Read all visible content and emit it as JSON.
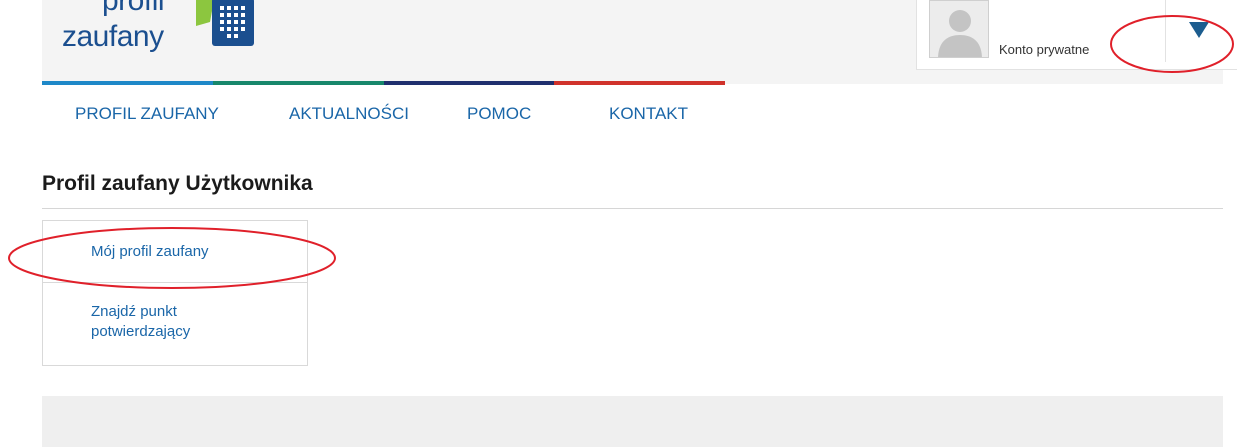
{
  "brand": {
    "logo_line1": "profil",
    "logo_line2": "zaufany",
    "colors": {
      "logo_text": "#1b4f8f",
      "logo_green": "#8cc63f",
      "stripes": [
        "#1e88c8",
        "#17876b",
        "#1f2f6e",
        "#d0322b"
      ]
    }
  },
  "account": {
    "label": "Konto prywatne",
    "avatar_icon": "user-silhouette-icon",
    "dropdown_icon": "triangle-down-icon"
  },
  "nav": {
    "items": [
      {
        "label": "PROFIL ZAUFANY"
      },
      {
        "label": "AKTUALNOŚCI"
      },
      {
        "label": "POMOC"
      },
      {
        "label": "KONTAKT"
      }
    ]
  },
  "page": {
    "title": "Profil zaufany Użytkownika"
  },
  "sidebar": {
    "items": [
      {
        "label": "Mój profil zaufany"
      },
      {
        "label": "Znajdź punkt potwierdzający"
      }
    ]
  },
  "annotations": {
    "color": "#e0202a"
  }
}
